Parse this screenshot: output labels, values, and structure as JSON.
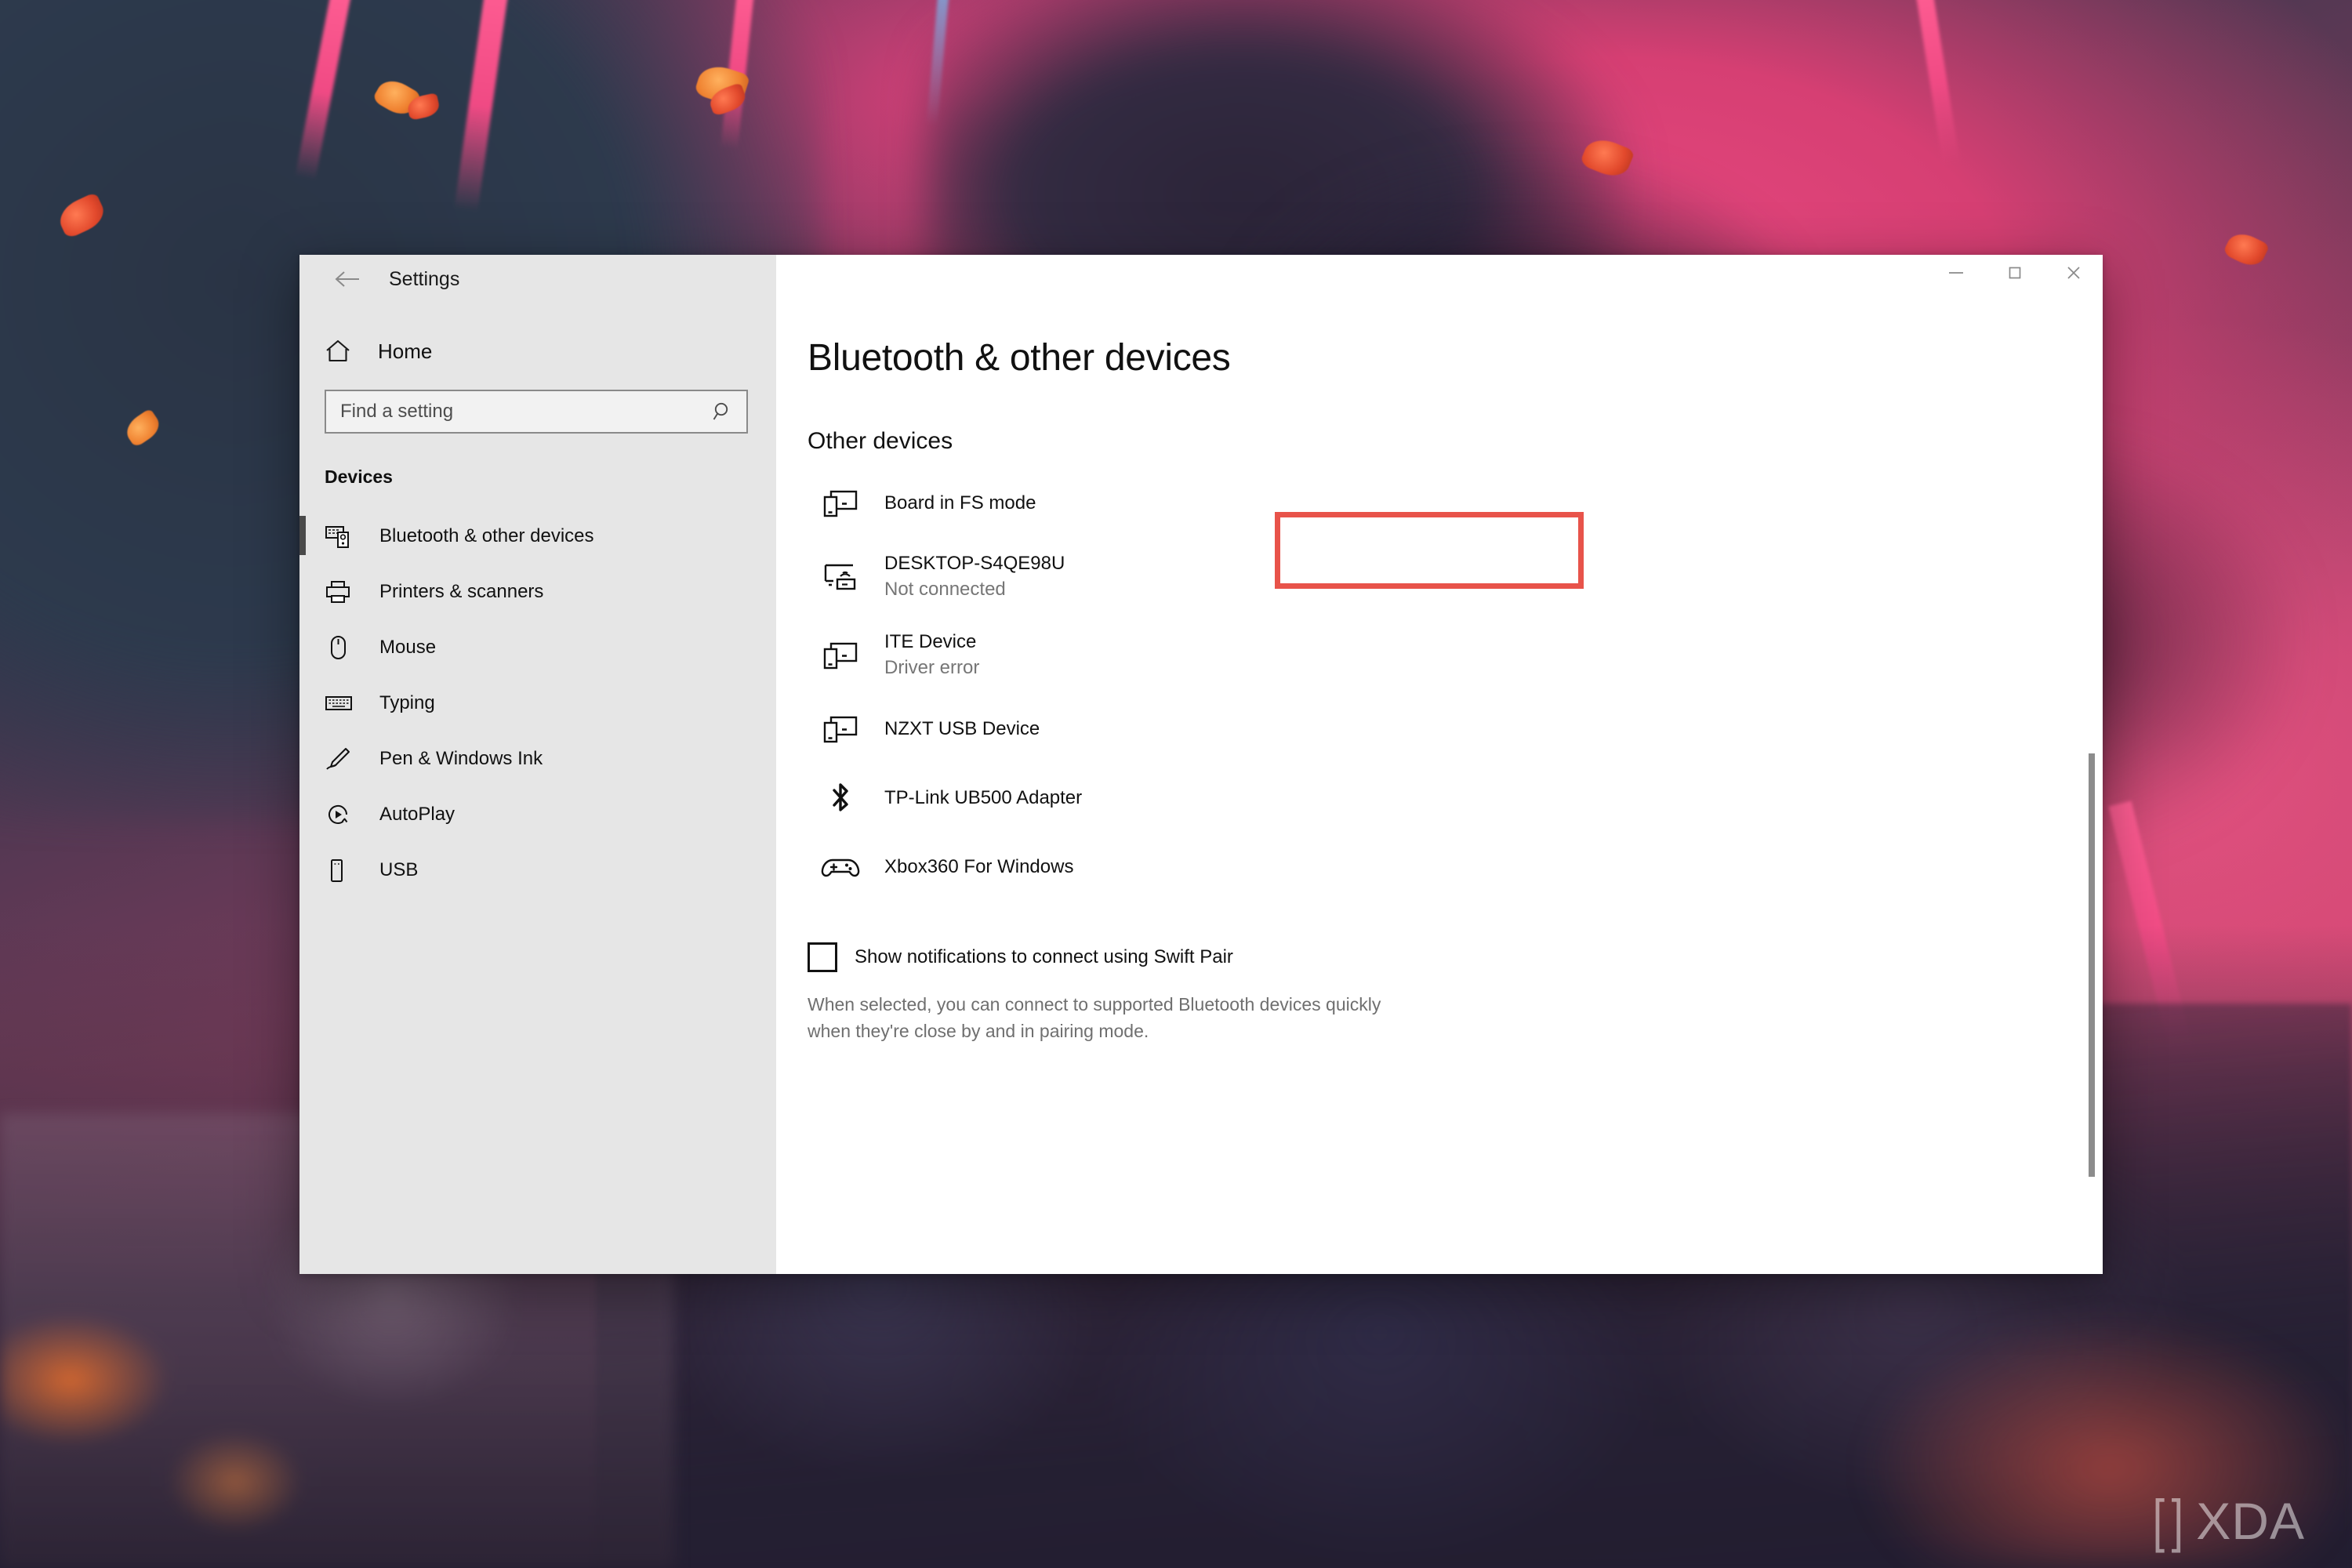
{
  "window": {
    "app_title": "Settings",
    "back_icon": "back-arrow-icon",
    "controls": {
      "minimize_label": "—",
      "maximize_label": "□",
      "close_label": "✕"
    }
  },
  "sidebar": {
    "home": {
      "label": "Home",
      "icon": "home-icon"
    },
    "search": {
      "value": "",
      "placeholder": "Find a setting",
      "icon": "search-icon"
    },
    "section_title": "Devices",
    "items": [
      {
        "label": "Bluetooth & other devices",
        "icon": "bluetooth-devices-icon",
        "selected": true
      },
      {
        "label": "Printers & scanners",
        "icon": "printer-icon",
        "selected": false
      },
      {
        "label": "Mouse",
        "icon": "mouse-icon",
        "selected": false
      },
      {
        "label": "Typing",
        "icon": "keyboard-icon",
        "selected": false
      },
      {
        "label": "Pen & Windows Ink",
        "icon": "pen-icon",
        "selected": false
      },
      {
        "label": "AutoPlay",
        "icon": "autoplay-icon",
        "selected": false
      },
      {
        "label": "USB",
        "icon": "usb-drive-icon",
        "selected": false
      }
    ]
  },
  "main": {
    "page_heading": "Bluetooth & other devices",
    "other_devices_heading": "Other devices",
    "devices": [
      {
        "name": "Board in FS mode",
        "status": "",
        "icon": "generic-device-icon",
        "highlighted": true
      },
      {
        "name": "DESKTOP-S4QE98U",
        "status": "Not connected",
        "icon": "wireless-display-icon",
        "highlighted": false
      },
      {
        "name": "ITE Device",
        "status": "Driver error",
        "icon": "generic-device-icon",
        "highlighted": false
      },
      {
        "name": "NZXT USB Device",
        "status": "",
        "icon": "generic-device-icon",
        "highlighted": false
      },
      {
        "name": "TP-Link UB500 Adapter",
        "status": "",
        "icon": "bluetooth-icon",
        "highlighted": false
      },
      {
        "name": "Xbox360 For Windows",
        "status": "",
        "icon": "gamepad-icon",
        "highlighted": false
      }
    ],
    "swift_pair": {
      "label": "Show notifications to connect using Swift Pair",
      "checked": false,
      "description": "When selected, you can connect to supported Bluetooth devices quickly when they're close by and in pairing mode."
    }
  },
  "annotation": {
    "color": "#e8534a",
    "target": "Board in FS mode"
  },
  "watermark": {
    "text": "XDA",
    "bracket_left": "[",
    "bracket_right": "]"
  },
  "colors": {
    "sidebar_bg": "#e6e6e6",
    "content_bg": "#ffffff",
    "accent_bar": "#4a4a4a",
    "status_text": "#767676",
    "annotation_red": "#e8534a"
  }
}
